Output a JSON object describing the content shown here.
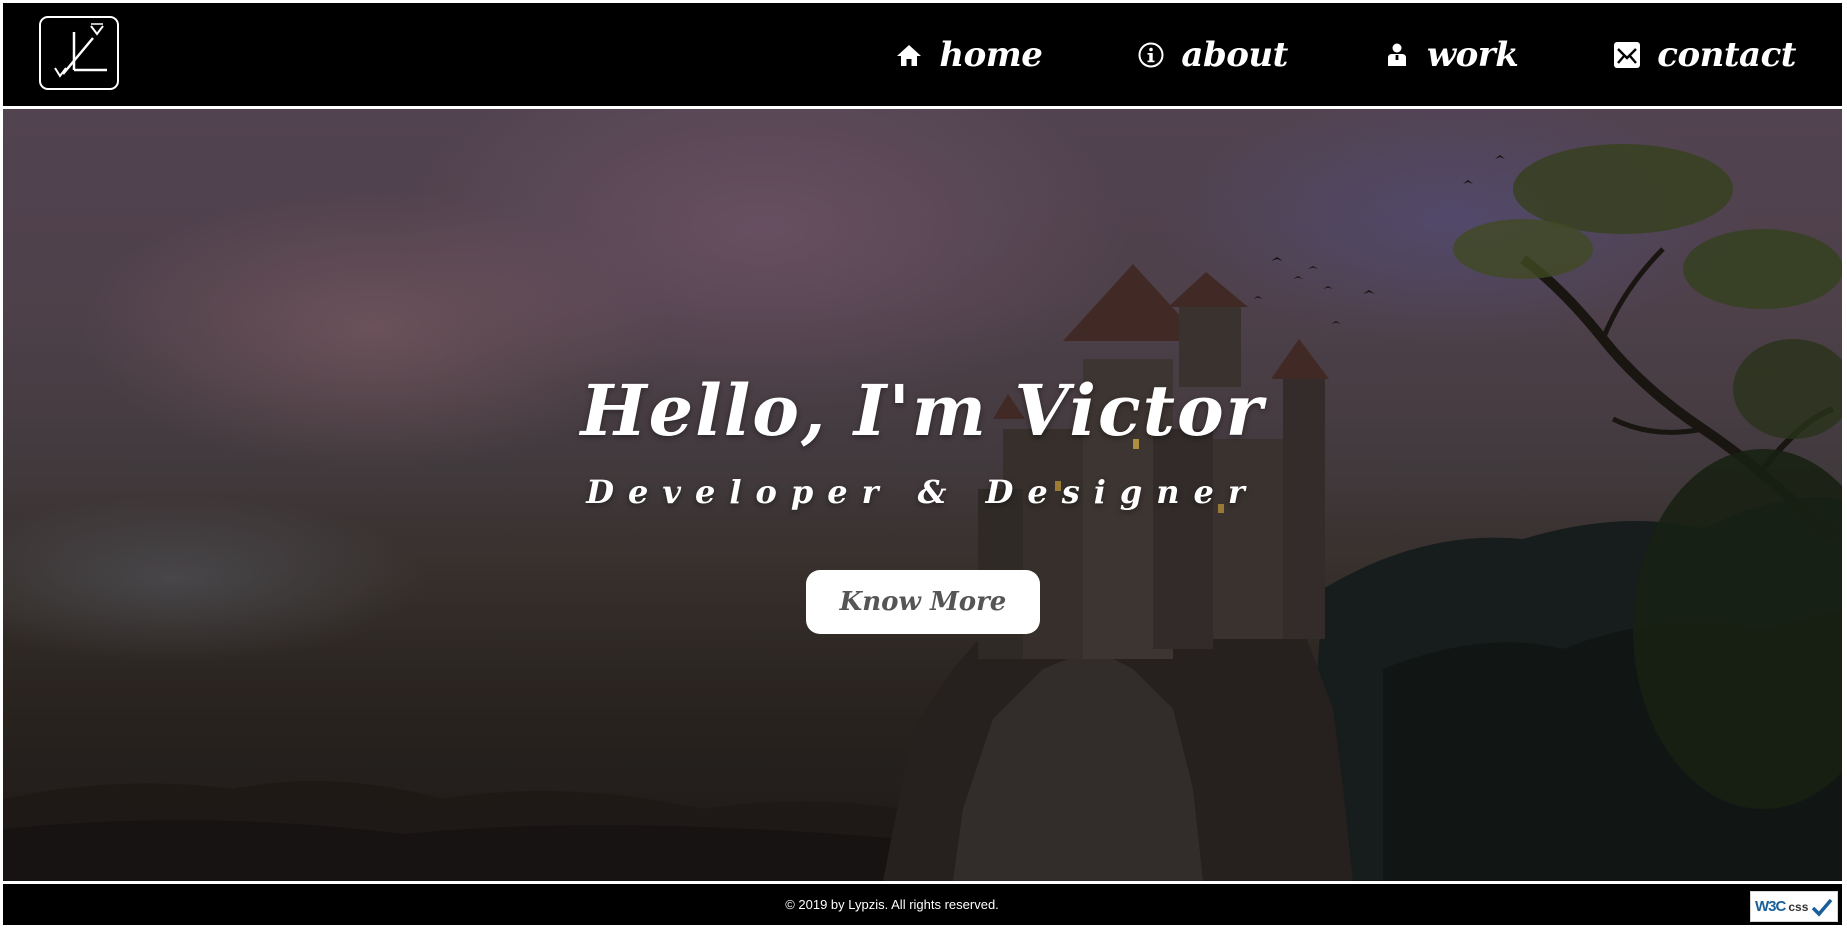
{
  "header": {
    "logo_alt": "Lypzis logo",
    "nav": [
      {
        "label": "home",
        "icon": "home-icon"
      },
      {
        "label": "about",
        "icon": "info-icon"
      },
      {
        "label": "work",
        "icon": "person-icon"
      },
      {
        "label": "contact",
        "icon": "envelope-icon"
      }
    ]
  },
  "hero": {
    "title": "Hello, I'm Victor",
    "subtitle": "Developer & Designer",
    "button_label": "Know More"
  },
  "footer": {
    "copyright": "© 2019 by Lypzis. All rights reserved.",
    "badge": {
      "logo": "W3C",
      "label": "css"
    }
  },
  "colors": {
    "header_bg": "#000000",
    "text": "#ffffff",
    "button_text": "#555555",
    "w3c_blue": "#1a5e9a"
  }
}
